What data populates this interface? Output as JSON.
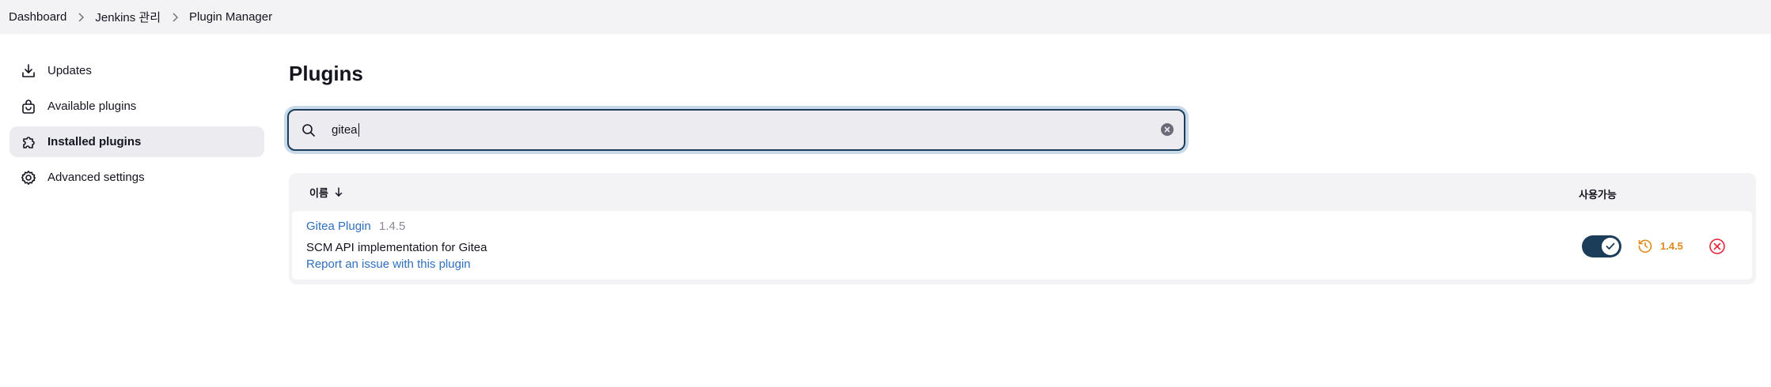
{
  "breadcrumb": {
    "items": [
      "Dashboard",
      "Jenkins 관리",
      "Plugin Manager"
    ],
    "separator_icon": "chevron-right-icon"
  },
  "sidebar": {
    "items": [
      {
        "label": "Updates",
        "icon": "download-icon",
        "active": false
      },
      {
        "label": "Available plugins",
        "icon": "shopping-bag-icon",
        "active": false
      },
      {
        "label": "Installed plugins",
        "icon": "puzzle-icon",
        "active": true
      },
      {
        "label": "Advanced settings",
        "icon": "gear-icon",
        "active": false
      }
    ]
  },
  "main": {
    "title": "Plugins",
    "search": {
      "value": "gitea",
      "icon": "search-icon",
      "clear_icon": "clear-icon"
    },
    "table": {
      "columns": {
        "name": "이름",
        "name_sort_icon": "arrow-down-icon",
        "enabled": "사용가능"
      },
      "rows": [
        {
          "name": "Gitea Plugin",
          "version": "1.4.5",
          "description": "SCM API implementation for Gitea",
          "report_link": "Report an issue with this plugin",
          "enabled": true,
          "downgrade_version": "1.4.5"
        }
      ]
    }
  },
  "colors": {
    "accent": "#1c3d5a",
    "link": "#2f6fbd",
    "warning": "#e08a1a",
    "danger": "#e5243b"
  }
}
